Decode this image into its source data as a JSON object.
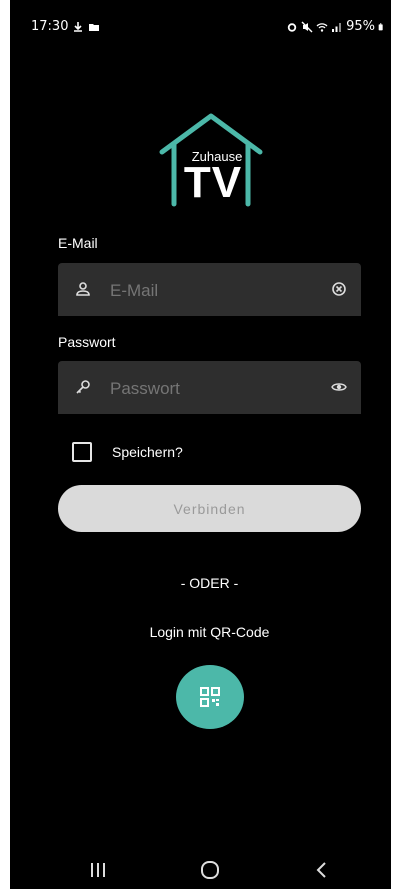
{
  "statusbar": {
    "time": "17:30",
    "battery": "95%"
  },
  "logo": {
    "subtitle": "Zuhause",
    "title": "TV"
  },
  "form": {
    "email_label": "E-Mail",
    "email_placeholder": "E-Mail",
    "password_label": "Passwort",
    "password_placeholder": "Passwort",
    "remember_label": "Speichern?",
    "connect_label": "Verbinden"
  },
  "alt_login": {
    "divider": "- ODER -",
    "qr_label": "Login mit QR-Code"
  },
  "colors": {
    "accent": "#4cb8a9",
    "background": "#000000",
    "field": "#2e2e2e"
  }
}
